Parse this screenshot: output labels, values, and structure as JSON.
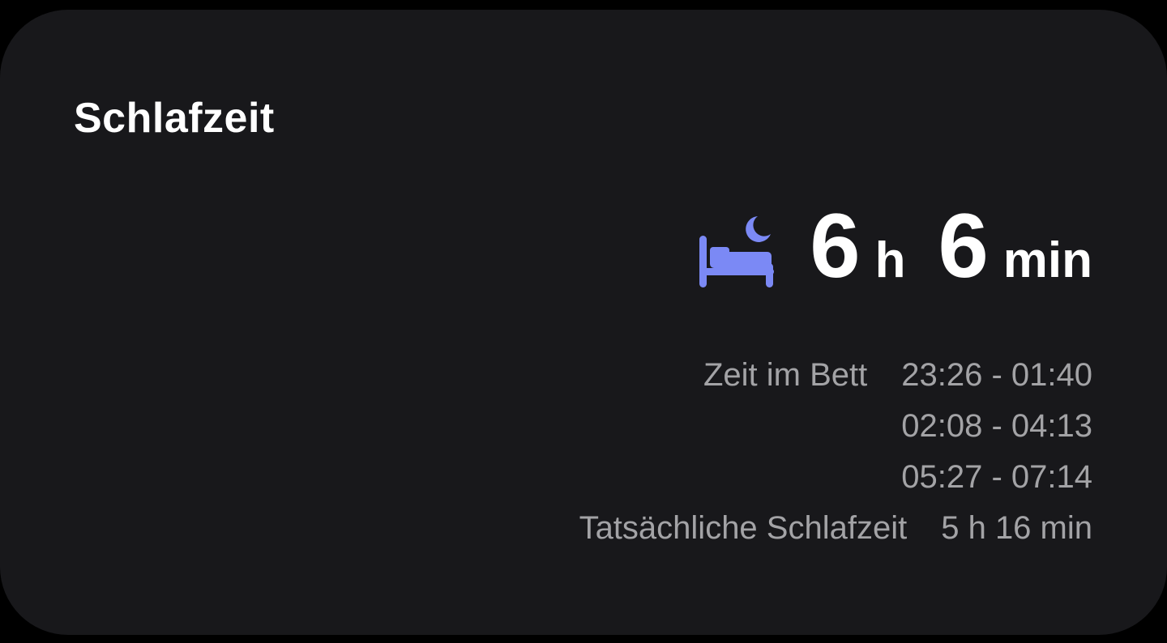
{
  "card": {
    "title": "Schlafzeit"
  },
  "duration": {
    "icon": "bed-moon-icon",
    "hours_value": "6",
    "hours_unit": "h",
    "minutes_value": "6",
    "minutes_unit": "min"
  },
  "details": {
    "time_in_bed_label": "Zeit im Bett",
    "time_in_bed_ranges": [
      "23:26 - 01:40",
      "02:08 - 04:13",
      "05:27 - 07:14"
    ],
    "actual_sleep_label": "Tatsächliche Schlafzeit",
    "actual_sleep_value": "5 h 16 min"
  },
  "colors": {
    "background": "#18181b",
    "accent": "#7b89f5",
    "primary_text": "#ffffff",
    "secondary_text": "#a3a3a6"
  }
}
